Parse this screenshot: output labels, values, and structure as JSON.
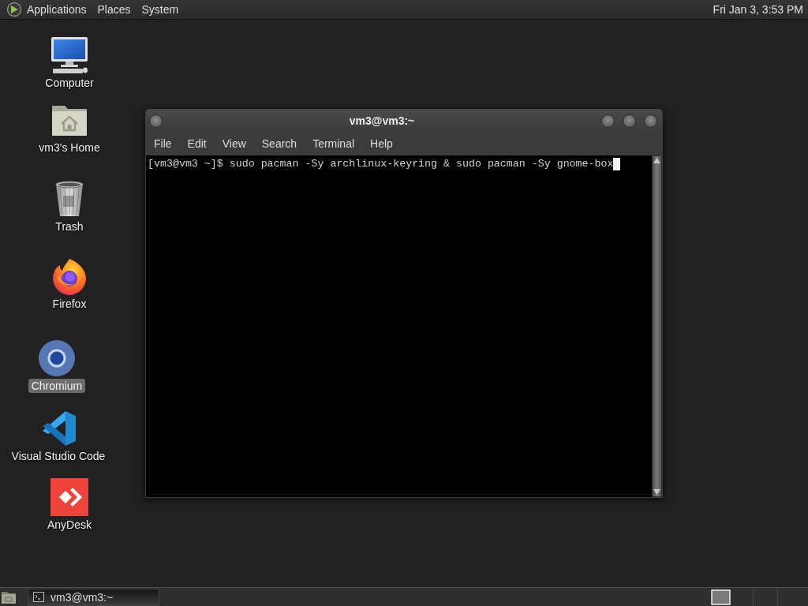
{
  "top_panel": {
    "menus": [
      "Applications",
      "Places",
      "System"
    ],
    "clock": "Fri Jan 3, 3:53 PM"
  },
  "desktop_icons": [
    {
      "label": "Computer",
      "kind": "computer",
      "selected": false
    },
    {
      "label": "vm3's Home",
      "kind": "home",
      "selected": false
    },
    {
      "label": "Trash",
      "kind": "trash",
      "selected": false
    },
    {
      "label": "Firefox",
      "kind": "firefox",
      "selected": false
    },
    {
      "label": "Chromium",
      "kind": "chromium",
      "selected": true
    },
    {
      "label": "Visual Studio Code",
      "kind": "vscode",
      "selected": false
    },
    {
      "label": "AnyDesk",
      "kind": "anydesk",
      "selected": false
    }
  ],
  "terminal_window": {
    "title": "vm3@vm3:~",
    "menus": [
      "File",
      "Edit",
      "View",
      "Search",
      "Terminal",
      "Help"
    ],
    "lines": [
      "[vm3@vm3 ~]$ sudo pacman -Sy archlinux-keyring & sudo pacman -Sy gnome-box"
    ],
    "cursor": true
  },
  "bottom_panel": {
    "tasks": [
      {
        "label": "vm3@vm3:~"
      }
    ]
  }
}
